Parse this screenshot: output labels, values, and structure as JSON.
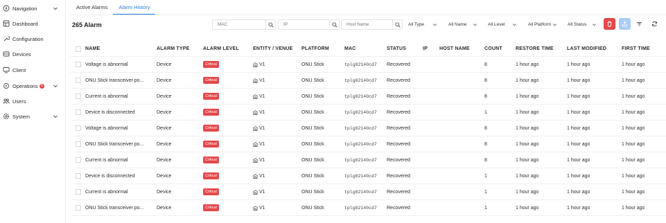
{
  "sidebar": {
    "items": [
      {
        "label": "Navigation",
        "icon": "compass-icon",
        "chevron": true
      },
      {
        "label": "Dashboard",
        "icon": "dashboard-icon",
        "chevron": false
      },
      {
        "label": "Configuration",
        "icon": "wrench-icon",
        "chevron": false
      },
      {
        "label": "Devices",
        "icon": "devices-icon",
        "chevron": false
      },
      {
        "label": "Client",
        "icon": "client-icon",
        "chevron": false
      },
      {
        "label": "Operations",
        "icon": "operations-icon",
        "chevron": true,
        "badge": "0"
      },
      {
        "label": "Users",
        "icon": "users-icon",
        "chevron": false
      },
      {
        "label": "System",
        "icon": "gear-icon",
        "chevron": true
      }
    ]
  },
  "tabs": [
    {
      "label": "Active Alarms",
      "active": false
    },
    {
      "label": "Alarm History",
      "active": true
    }
  ],
  "header": {
    "count_label": "265 Alarm",
    "mac_placeholder": "MAC",
    "ip_placeholder": "IP",
    "host_placeholder": "Host Name",
    "filters": {
      "type": "All Type",
      "name": "All Name",
      "level": "All Level",
      "platform": "All Platform",
      "status": "All Status"
    }
  },
  "columns": [
    "NAME",
    "ALARM TYPE",
    "ALARM LEVEL",
    "ENTITY / VENUE",
    "PLATFORM",
    "MAC",
    "STATUS",
    "IP",
    "HOST NAME",
    "COUNT",
    "RESTORE TIME",
    "LAST MODIFIED",
    "FIRST TIME"
  ],
  "rows": [
    {
      "name": "Voltage is abnormal",
      "type": "Device",
      "level": "Critical",
      "venue": "V1",
      "platform": "ONU Stick",
      "mac": "tplg82140cd7",
      "status": "Recovered",
      "ip": "",
      "host": "",
      "count": "8",
      "restore": "1 hour ago",
      "modified": "1 hour ago",
      "first": "1 hour ago"
    },
    {
      "name": "ONU Stick transceiver po...",
      "type": "Device",
      "level": "Critical",
      "venue": "V1",
      "platform": "ONU Stick",
      "mac": "tplg82140cd7",
      "status": "Recovered",
      "ip": "",
      "host": "",
      "count": "8",
      "restore": "1 hour ago",
      "modified": "1 hour ago",
      "first": "1 hour ago"
    },
    {
      "name": "Current is abnormal",
      "type": "Device",
      "level": "Critical",
      "venue": "V1",
      "platform": "ONU Stick",
      "mac": "tplg82140cd7",
      "status": "Recovered",
      "ip": "",
      "host": "",
      "count": "8",
      "restore": "1 hour ago",
      "modified": "1 hour ago",
      "first": "1 hour ago"
    },
    {
      "name": "Device is disconnected",
      "type": "Device",
      "level": "Critical",
      "venue": "V1",
      "platform": "ONU Stick",
      "mac": "tplg82140cd7",
      "status": "Recovered",
      "ip": "",
      "host": "",
      "count": "1",
      "restore": "1 hour ago",
      "modified": "1 hour ago",
      "first": "1 hour ago"
    },
    {
      "name": "Voltage is abnormal",
      "type": "Device",
      "level": "Critical",
      "venue": "V1",
      "platform": "ONU Stick",
      "mac": "tplg82140cd7",
      "status": "Recovered",
      "ip": "",
      "host": "",
      "count": "8",
      "restore": "1 hour ago",
      "modified": "1 hour ago",
      "first": "1 hour ago"
    },
    {
      "name": "ONU Stick transceiver po...",
      "type": "Device",
      "level": "Critical",
      "venue": "V1",
      "platform": "ONU Stick",
      "mac": "tplg82140cd7",
      "status": "Recovered",
      "ip": "",
      "host": "",
      "count": "8",
      "restore": "1 hour ago",
      "modified": "1 hour ago",
      "first": "1 hour ago"
    },
    {
      "name": "Current is abnormal",
      "type": "Device",
      "level": "Critical",
      "venue": "V1",
      "platform": "ONU Stick",
      "mac": "tplg82140cd7",
      "status": "Recovered",
      "ip": "",
      "host": "",
      "count": "8",
      "restore": "1 hour ago",
      "modified": "1 hour ago",
      "first": "1 hour ago"
    },
    {
      "name": "Device is disconnected",
      "type": "Device",
      "level": "Critical",
      "venue": "V1",
      "platform": "ONU Stick",
      "mac": "tplg82140cd7",
      "status": "Recovered",
      "ip": "",
      "host": "",
      "count": "1",
      "restore": "1 hour ago",
      "modified": "1 hour ago",
      "first": "1 hour ago"
    },
    {
      "name": "Current is abnormal",
      "type": "Device",
      "level": "Critical",
      "venue": "V1",
      "platform": "ONU Stick",
      "mac": "tplg82140cd7",
      "status": "Recovered",
      "ip": "",
      "host": "",
      "count": "1",
      "restore": "1 hour ago",
      "modified": "1 hour ago",
      "first": "1 hour ago"
    },
    {
      "name": "ONU Stick transceiver po...",
      "type": "Device",
      "level": "Critical",
      "venue": "V1",
      "platform": "ONU Stick",
      "mac": "tplg82140cd7",
      "status": "Recovered",
      "ip": "",
      "host": "",
      "count": "1",
      "restore": "1 hour ago",
      "modified": "1 hour ago",
      "first": "1 hour ago"
    }
  ],
  "colors": {
    "accent": "#2a7ae2",
    "critical": "#e4484a",
    "delete_button": "#e4484a",
    "export_button": "#a9cdf5"
  }
}
